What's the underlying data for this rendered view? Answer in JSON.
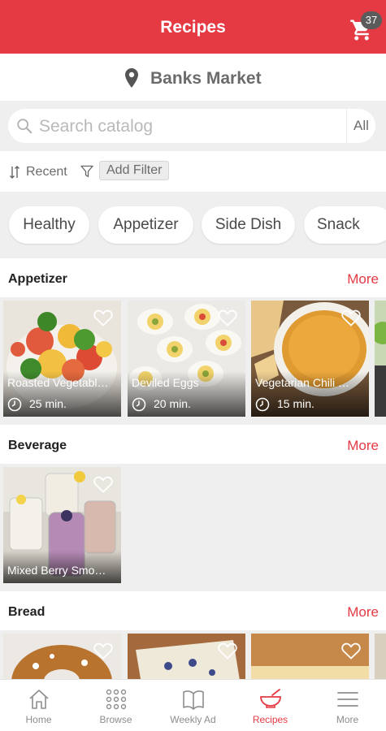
{
  "header": {
    "title": "Recipes",
    "cart_count": "37"
  },
  "store": {
    "name": "Banks Market"
  },
  "search": {
    "placeholder": "Search catalog",
    "scope": "All"
  },
  "filters": {
    "sort_label": "Recent",
    "add_filter_label": "Add Filter"
  },
  "categories": [
    "Healthy",
    "Appetizer",
    "Side Dish",
    "Snack"
  ],
  "sections": [
    {
      "title": "Appetizer",
      "more_label": "More",
      "recipes": [
        {
          "name": "Roasted Vegetabl…",
          "time": "25 min."
        },
        {
          "name": "Deviled Eggs",
          "time": "20 min."
        },
        {
          "name": "Vegetarian Chili …",
          "time": "15 min."
        }
      ]
    },
    {
      "title": "Beverage",
      "more_label": "More",
      "recipes": [
        {
          "name": "Mixed Berry Smo…"
        }
      ]
    },
    {
      "title": "Bread",
      "more_label": "More"
    }
  ],
  "bottom_nav": [
    {
      "label": "Home",
      "icon": "home-icon"
    },
    {
      "label": "Browse",
      "icon": "grid-icon"
    },
    {
      "label": "Weekly Ad",
      "icon": "book-icon"
    },
    {
      "label": "Recipes",
      "icon": "bowl-icon",
      "active": true
    },
    {
      "label": "More",
      "icon": "menu-icon"
    }
  ],
  "colors": {
    "accent": "#e53a44",
    "badge": "#5b5b5b",
    "background": "#efefef"
  }
}
